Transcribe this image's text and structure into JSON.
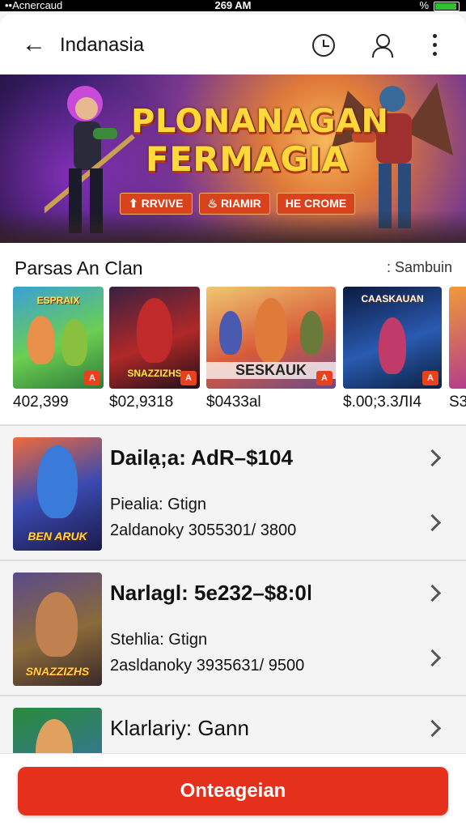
{
  "status_bar": {
    "carrier": "••Acnercaud",
    "time": "269 AM",
    "battery_percent": "%"
  },
  "app_bar": {
    "title": "Indanasia",
    "icons": [
      "back-arrow-icon",
      "clock-download-icon",
      "user-icon",
      "more-vert-icon"
    ]
  },
  "banner": {
    "title_line1": "PLONANAGAN",
    "title_line2": "FERMAGIA",
    "chips": [
      "⬆ RRVIVE",
      "♨ RIAMIR",
      "HE CROME"
    ]
  },
  "section": {
    "label": "Parsas An Clan",
    "link": ": Sambuin"
  },
  "carousel": {
    "items": [
      {
        "caption": "ESPRAIX",
        "price": "402,399"
      },
      {
        "caption": "SNAZZIZHS",
        "price": "$02,9318"
      },
      {
        "caption": "SESKAUK",
        "price": "$0433al"
      },
      {
        "caption": "CAASKAUAN",
        "price": "$.00;3.3ЛI4"
      },
      {
        "caption": "",
        "price": "S3"
      }
    ]
  },
  "list": {
    "items": [
      {
        "name": "Dailạ;a: AdR–$104",
        "sub1": "Piealia: Gtign",
        "sub2": "2aldanoky 3055301/ 3800",
        "thumb_caption": "BEN ARUK"
      },
      {
        "name": "Narlagl: 5e232–$8:0ǀ",
        "sub1": "Stehlia: Gtign",
        "sub2": "2asldanoky 3935631/ 9500",
        "thumb_caption": "SNAZZIZHS"
      },
      {
        "name": "Klarlariy: Gann",
        "sub1": "",
        "sub2": "",
        "thumb_caption": ""
      }
    ]
  },
  "cta": {
    "label": "Onteageian"
  },
  "colors": {
    "accent": "#e5301c",
    "title_gold": "#ffd83a",
    "chip": "#d8421c"
  }
}
